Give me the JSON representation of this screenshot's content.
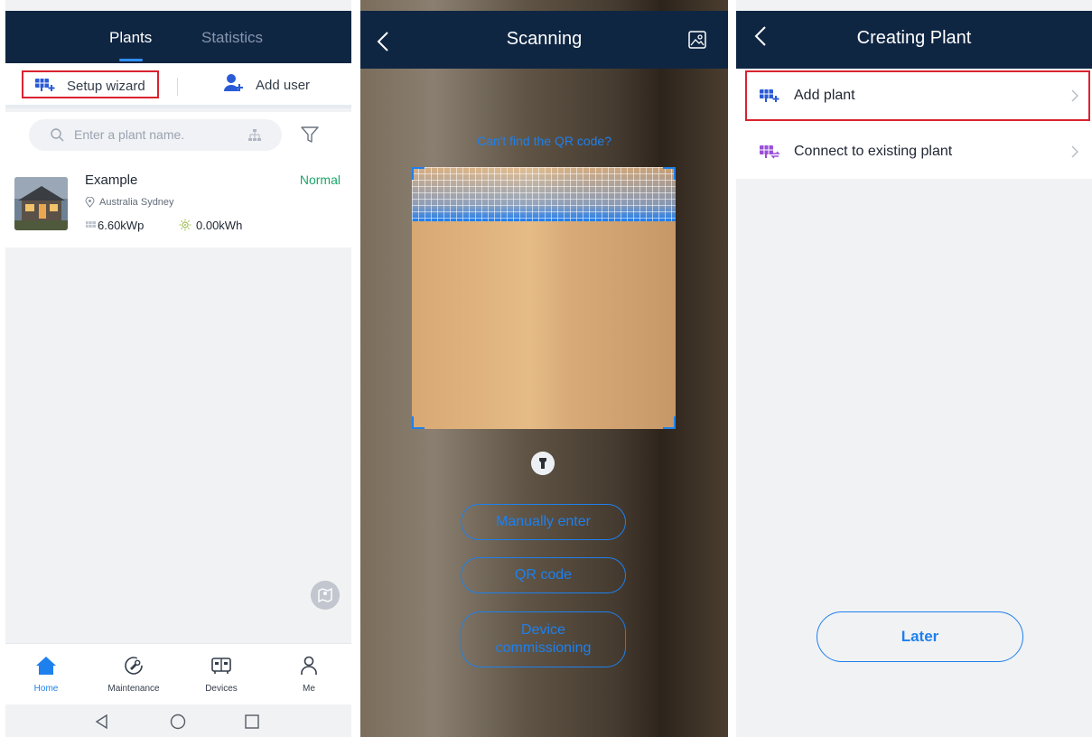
{
  "screen1": {
    "tabs": {
      "plants": "Plants",
      "statistics": "Statistics"
    },
    "actions": {
      "setup_wizard": "Setup wizard",
      "add_user": "Add user"
    },
    "search": {
      "placeholder": "Enter a plant name."
    },
    "plant": {
      "name": "Example",
      "status": "Normal",
      "location": "Australia Sydney",
      "capacity": "6.60kWp",
      "energy": "0.00kWh"
    },
    "nav": {
      "home": "Home",
      "maintenance": "Maintenance",
      "devices": "Devices",
      "me": "Me"
    }
  },
  "screen2": {
    "title": "Scanning",
    "help_link": "Can't find the QR code?",
    "buttons": {
      "manual": "Manually enter",
      "qr": "QR code",
      "commissioning_line1": "Device",
      "commissioning_line2": "commissioning"
    }
  },
  "screen3": {
    "title": "Creating Plant",
    "items": {
      "add_plant": "Add plant",
      "connect_existing": "Connect to existing plant"
    },
    "later": "Later"
  },
  "colors": {
    "header": "#0f2643",
    "accent": "#1e80ed",
    "status_normal": "#1aa66a",
    "highlight_box": "#d9232f"
  }
}
